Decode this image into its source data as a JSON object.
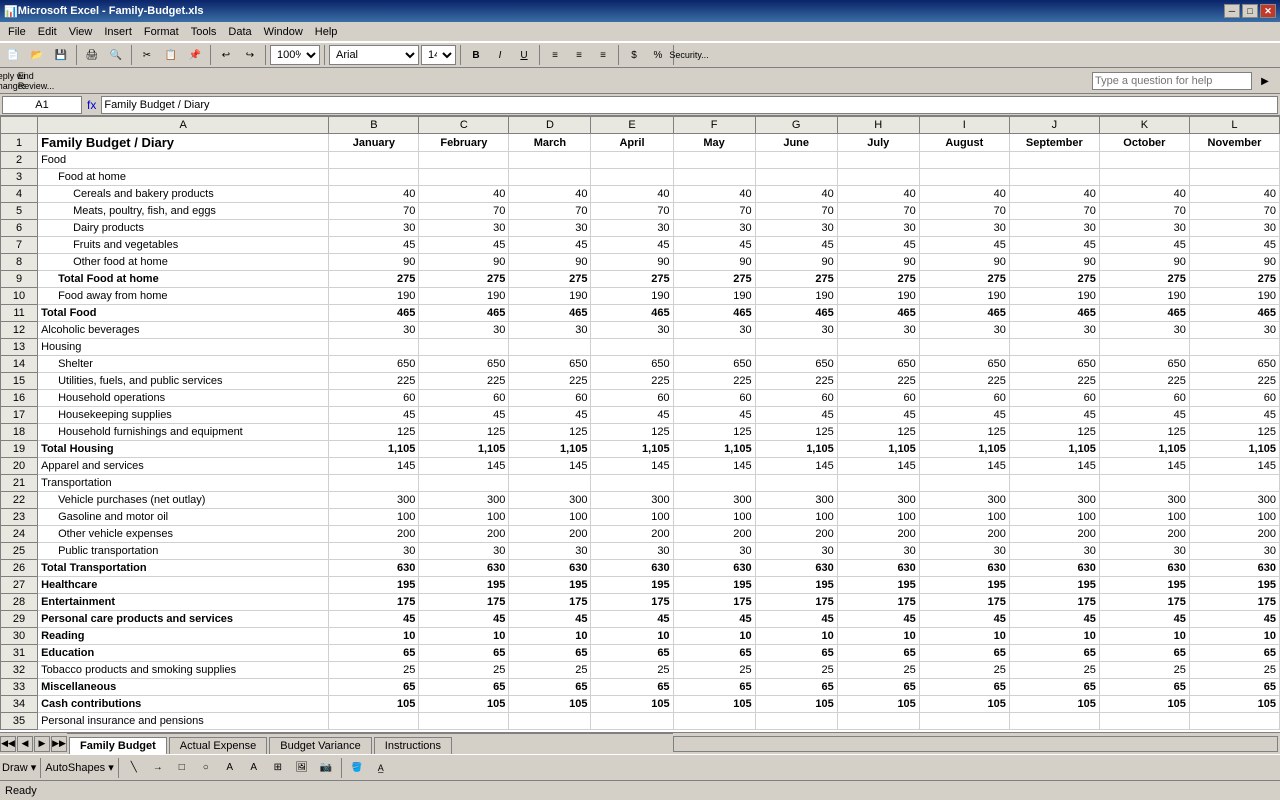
{
  "window": {
    "title": "Microsoft Excel - Family-Budget.xls",
    "icon": "📊"
  },
  "titleBar": {
    "title": "Microsoft Excel - Family-Budget.xls",
    "minBtn": "─",
    "maxBtn": "□",
    "closeBtn": "✕"
  },
  "menuBar": {
    "items": [
      "File",
      "Edit",
      "View",
      "Insert",
      "Format",
      "Tools",
      "Data",
      "Window",
      "Help"
    ]
  },
  "toolbar1": {
    "zoom": "100%",
    "font": "Arial",
    "fontSize": "14"
  },
  "formulaBar": {
    "nameBox": "A1",
    "formula": "Family Budget / Diary"
  },
  "helpBox": {
    "placeholder": "Type a question for help"
  },
  "columns": {
    "headers": [
      "",
      "A",
      "B",
      "C",
      "D",
      "E",
      "F",
      "G",
      "H",
      "I",
      "J",
      "K",
      "L"
    ],
    "monthHeaders": [
      "January",
      "February",
      "March",
      "April",
      "May",
      "June",
      "July",
      "August",
      "September",
      "October",
      "November"
    ]
  },
  "rows": [
    {
      "rowNum": "1",
      "a": "Family Budget / Diary",
      "bold": true,
      "isHeader": true,
      "values": [
        "January",
        "February",
        "March",
        "April",
        "May",
        "June",
        "July",
        "August",
        "September",
        "October",
        "November"
      ]
    },
    {
      "rowNum": "2",
      "a": "Food",
      "bold": false,
      "values": []
    },
    {
      "rowNum": "3",
      "a": "  Food at home",
      "bold": false,
      "values": []
    },
    {
      "rowNum": "4",
      "a": "    Cereals and bakery products",
      "bold": false,
      "values": [
        40,
        40,
        40,
        40,
        40,
        40,
        40,
        40,
        40,
        40,
        40
      ]
    },
    {
      "rowNum": "5",
      "a": "    Meats, poultry, fish, and eggs",
      "bold": false,
      "values": [
        70,
        70,
        70,
        70,
        70,
        70,
        70,
        70,
        70,
        70,
        70
      ]
    },
    {
      "rowNum": "6",
      "a": "    Dairy products",
      "bold": false,
      "values": [
        30,
        30,
        30,
        30,
        30,
        30,
        30,
        30,
        30,
        30,
        30
      ]
    },
    {
      "rowNum": "7",
      "a": "    Fruits and vegetables",
      "bold": false,
      "values": [
        45,
        45,
        45,
        45,
        45,
        45,
        45,
        45,
        45,
        45,
        45
      ]
    },
    {
      "rowNum": "8",
      "a": "    Other food at home",
      "bold": false,
      "values": [
        90,
        90,
        90,
        90,
        90,
        90,
        90,
        90,
        90,
        90,
        90
      ]
    },
    {
      "rowNum": "9",
      "a": "  Total Food at home",
      "bold": true,
      "values": [
        275,
        275,
        275,
        275,
        275,
        275,
        275,
        275,
        275,
        275,
        275
      ]
    },
    {
      "rowNum": "10",
      "a": "  Food away from home",
      "bold": false,
      "values": [
        190,
        190,
        190,
        190,
        190,
        190,
        190,
        190,
        190,
        190,
        190
      ]
    },
    {
      "rowNum": "11",
      "a": "Total Food",
      "bold": true,
      "values": [
        465,
        465,
        465,
        465,
        465,
        465,
        465,
        465,
        465,
        465,
        465
      ]
    },
    {
      "rowNum": "12",
      "a": "Alcoholic beverages",
      "bold": false,
      "values": [
        30,
        30,
        30,
        30,
        30,
        30,
        30,
        30,
        30,
        30,
        30
      ]
    },
    {
      "rowNum": "13",
      "a": "Housing",
      "bold": false,
      "values": []
    },
    {
      "rowNum": "14",
      "a": "  Shelter",
      "bold": false,
      "values": [
        650,
        650,
        650,
        650,
        650,
        650,
        650,
        650,
        650,
        650,
        650
      ]
    },
    {
      "rowNum": "15",
      "a": "  Utilities, fuels, and public services",
      "bold": false,
      "values": [
        225,
        225,
        225,
        225,
        225,
        225,
        225,
        225,
        225,
        225,
        225
      ]
    },
    {
      "rowNum": "16",
      "a": "  Household operations",
      "bold": false,
      "values": [
        60,
        60,
        60,
        60,
        60,
        60,
        60,
        60,
        60,
        60,
        60
      ]
    },
    {
      "rowNum": "17",
      "a": "  Housekeeping supplies",
      "bold": false,
      "values": [
        45,
        45,
        45,
        45,
        45,
        45,
        45,
        45,
        45,
        45,
        45
      ]
    },
    {
      "rowNum": "18",
      "a": "  Household furnishings and equipment",
      "bold": false,
      "values": [
        125,
        125,
        125,
        125,
        125,
        125,
        125,
        125,
        125,
        125,
        125
      ]
    },
    {
      "rowNum": "19",
      "a": "Total Housing",
      "bold": true,
      "values": [
        "1,105",
        "1,105",
        "1,105",
        "1,105",
        "1,105",
        "1,105",
        "1,105",
        "1,105",
        "1,105",
        "1,105",
        "1,105"
      ]
    },
    {
      "rowNum": "20",
      "a": "Apparel and services",
      "bold": false,
      "values": [
        145,
        145,
        145,
        145,
        145,
        145,
        145,
        145,
        145,
        145,
        145
      ]
    },
    {
      "rowNum": "21",
      "a": "Transportation",
      "bold": false,
      "values": []
    },
    {
      "rowNum": "22",
      "a": "  Vehicle purchases (net outlay)",
      "bold": false,
      "values": [
        300,
        300,
        300,
        300,
        300,
        300,
        300,
        300,
        300,
        300,
        300
      ]
    },
    {
      "rowNum": "23",
      "a": "  Gasoline and motor oil",
      "bold": false,
      "values": [
        100,
        100,
        100,
        100,
        100,
        100,
        100,
        100,
        100,
        100,
        100
      ]
    },
    {
      "rowNum": "24",
      "a": "  Other vehicle expenses",
      "bold": false,
      "values": [
        200,
        200,
        200,
        200,
        200,
        200,
        200,
        200,
        200,
        200,
        200
      ]
    },
    {
      "rowNum": "25",
      "a": "  Public transportation",
      "bold": false,
      "values": [
        30,
        30,
        30,
        30,
        30,
        30,
        30,
        30,
        30,
        30,
        30
      ]
    },
    {
      "rowNum": "26",
      "a": "Total Transportation",
      "bold": true,
      "values": [
        630,
        630,
        630,
        630,
        630,
        630,
        630,
        630,
        630,
        630,
        630
      ]
    },
    {
      "rowNum": "27",
      "a": "Healthcare",
      "bold": true,
      "values": [
        195,
        195,
        195,
        195,
        195,
        195,
        195,
        195,
        195,
        195,
        195
      ]
    },
    {
      "rowNum": "28",
      "a": "Entertainment",
      "bold": true,
      "values": [
        175,
        175,
        175,
        175,
        175,
        175,
        175,
        175,
        175,
        175,
        175
      ]
    },
    {
      "rowNum": "29",
      "a": "Personal care products and services",
      "bold": true,
      "values": [
        45,
        45,
        45,
        45,
        45,
        45,
        45,
        45,
        45,
        45,
        45
      ]
    },
    {
      "rowNum": "30",
      "a": "Reading",
      "bold": true,
      "values": [
        10,
        10,
        10,
        10,
        10,
        10,
        10,
        10,
        10,
        10,
        10
      ]
    },
    {
      "rowNum": "31",
      "a": "Education",
      "bold": true,
      "values": [
        65,
        65,
        65,
        65,
        65,
        65,
        65,
        65,
        65,
        65,
        65
      ]
    },
    {
      "rowNum": "32",
      "a": "Tobacco products and smoking supplies",
      "bold": false,
      "values": [
        25,
        25,
        25,
        25,
        25,
        25,
        25,
        25,
        25,
        25,
        25
      ]
    },
    {
      "rowNum": "33",
      "a": "Miscellaneous",
      "bold": true,
      "values": [
        65,
        65,
        65,
        65,
        65,
        65,
        65,
        65,
        65,
        65,
        65
      ]
    },
    {
      "rowNum": "34",
      "a": "Cash contributions",
      "bold": true,
      "values": [
        105,
        105,
        105,
        105,
        105,
        105,
        105,
        105,
        105,
        105,
        105
      ]
    },
    {
      "rowNum": "35",
      "a": "Personal insurance and pensions",
      "bold": false,
      "values": []
    }
  ],
  "sheetTabs": [
    "Family Budget",
    "Actual Expense",
    "Budget Variance",
    "Instructions"
  ],
  "activeTab": "Family Budget",
  "statusBar": {
    "text": "Ready"
  },
  "drawingToolbar": {
    "draw": "Draw ▾",
    "autoshapes": "AutoShapes ▾"
  }
}
